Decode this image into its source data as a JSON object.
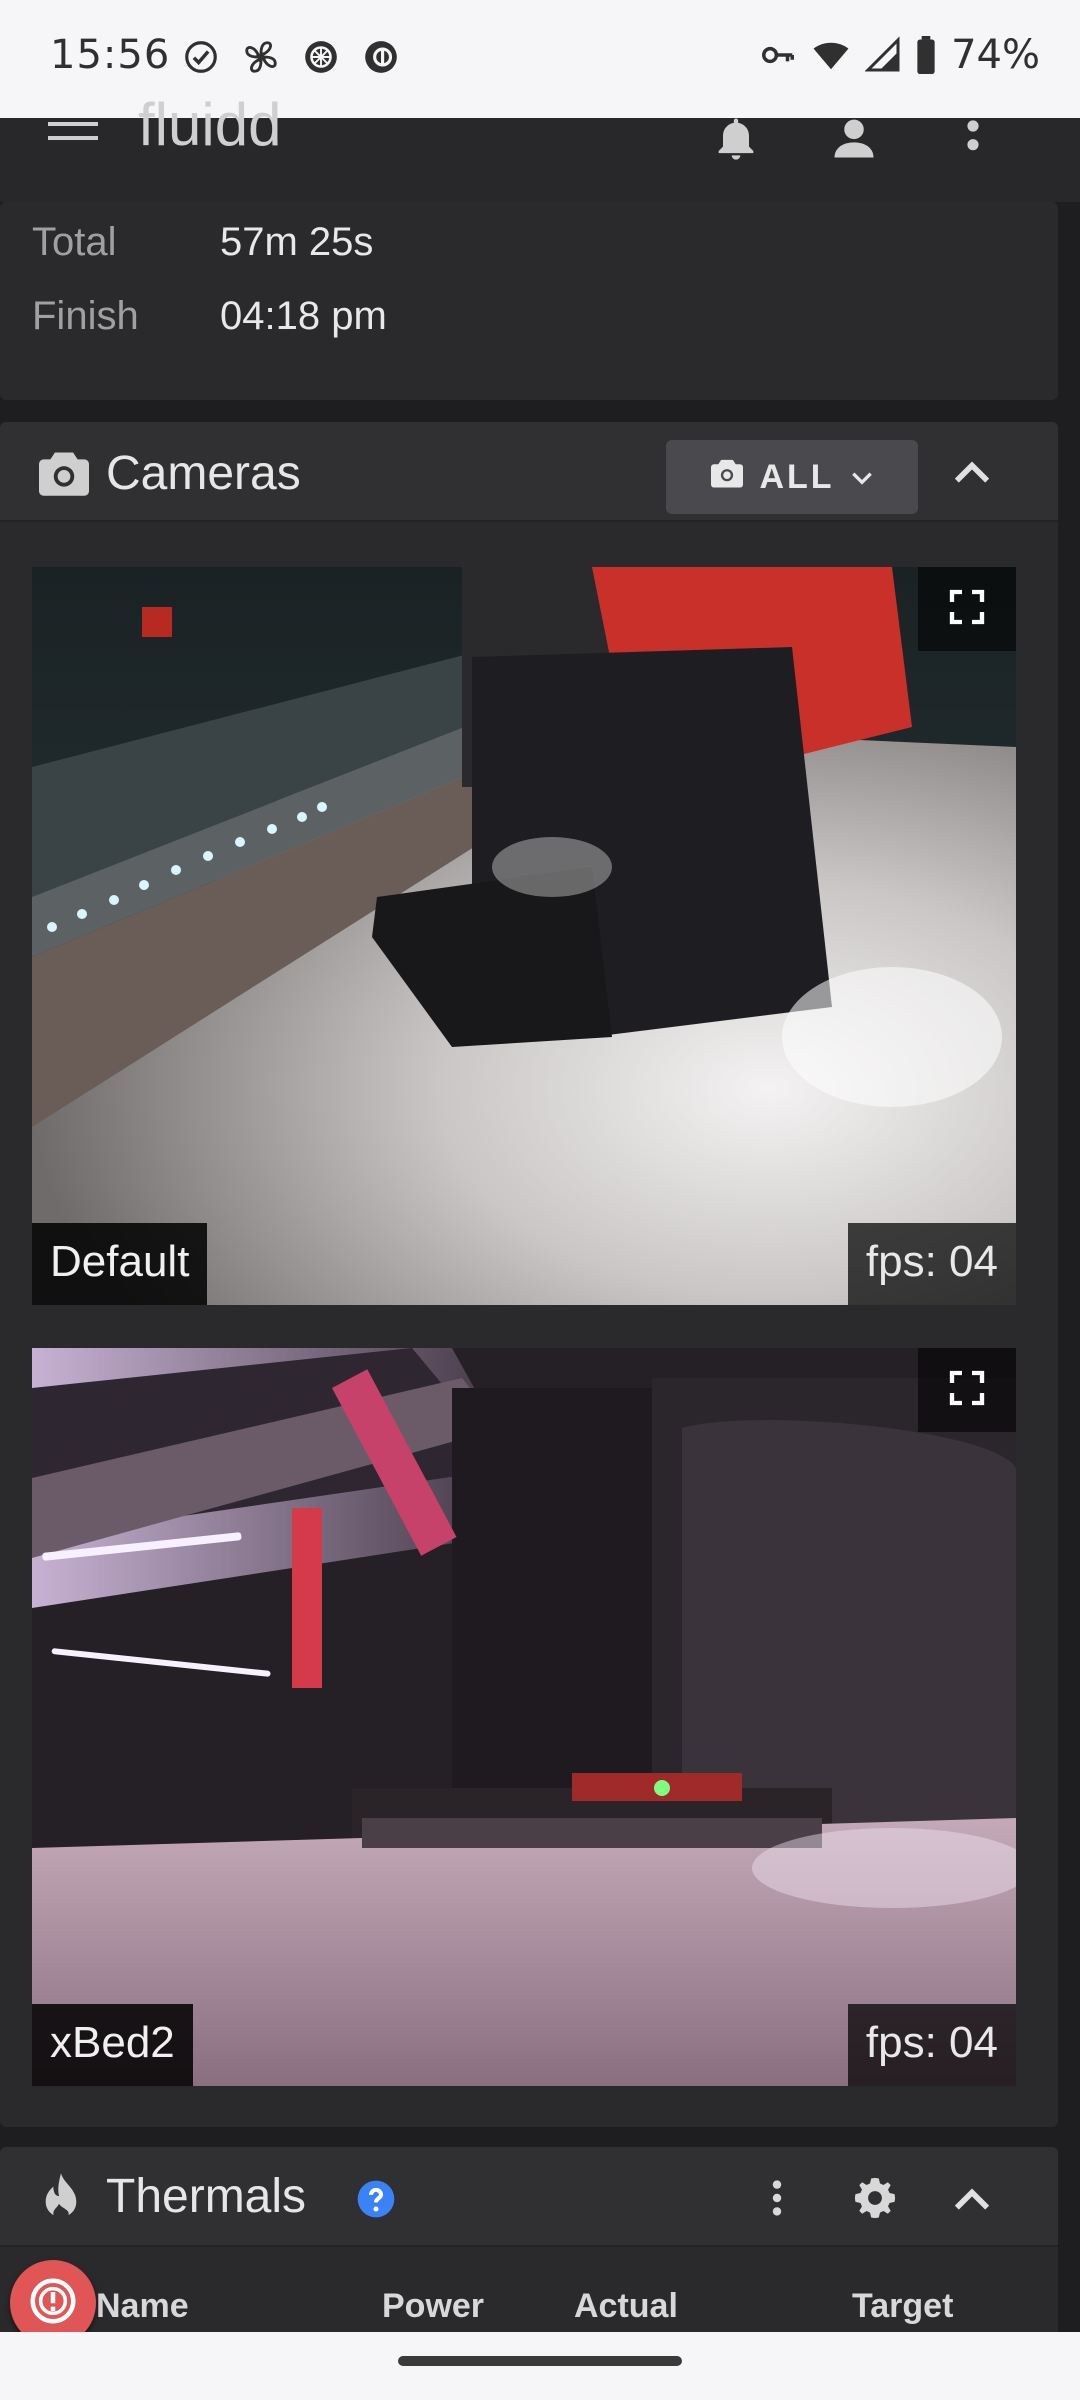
{
  "status_bar": {
    "time": "15:56",
    "battery": "74%",
    "left_icons": [
      "check-circle-icon",
      "fan-icon",
      "wheel-icon",
      "app-circle-icon"
    ],
    "right_icons": [
      "key-icon",
      "wifi-icon",
      "signal-icon",
      "battery-icon"
    ]
  },
  "app_bar": {
    "title": "fluidd",
    "icons": [
      "menu-icon",
      "bell-icon",
      "account-icon",
      "more-vert-icon"
    ]
  },
  "print_status": {
    "rows": [
      {
        "label": "Total",
        "value": "57m 25s"
      },
      {
        "label": "Finish",
        "value": "04:18 pm"
      }
    ]
  },
  "cameras": {
    "title": "Cameras",
    "filter_label": "ALL",
    "feeds": [
      {
        "name": "Default",
        "fps": "fps: 04"
      },
      {
        "name": "xBed2",
        "fps": "fps: 04"
      }
    ]
  },
  "thermals": {
    "title": "Thermals",
    "columns": [
      "Name",
      "Power",
      "Actual",
      "Target"
    ]
  },
  "colors": {
    "background": "#1e1e20",
    "card": "#2a2a2d",
    "accent_help": "#3b82f6",
    "alert": "#e05555"
  }
}
